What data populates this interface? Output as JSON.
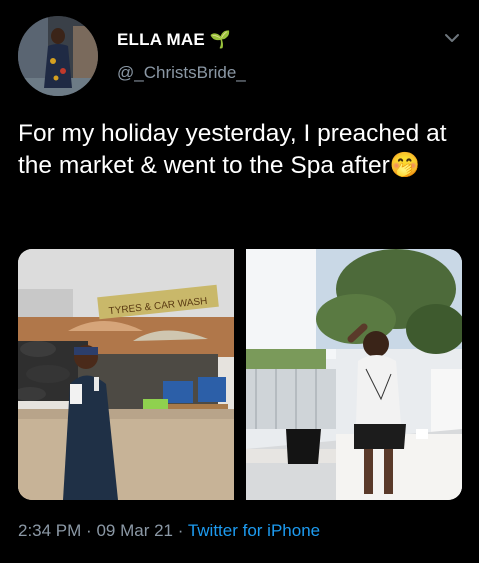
{
  "tweet": {
    "display_name": "ELLA MAE 🌱",
    "username": "@_ChristsBride_",
    "text": "For my holiday yesterday, I preached at the market & went to the Spa after🤭",
    "time": "2:34 PM",
    "separator": "·",
    "date": "09 Mar 21",
    "source": "Twitter for iPhone"
  },
  "media": {
    "left_sign_text": "TYRES & CAR WASH"
  },
  "colors": {
    "background": "#000000",
    "secondary_text": "#8b98a5",
    "link": "#1d9bf0"
  },
  "icons": {
    "more": "chevron-down-icon"
  }
}
